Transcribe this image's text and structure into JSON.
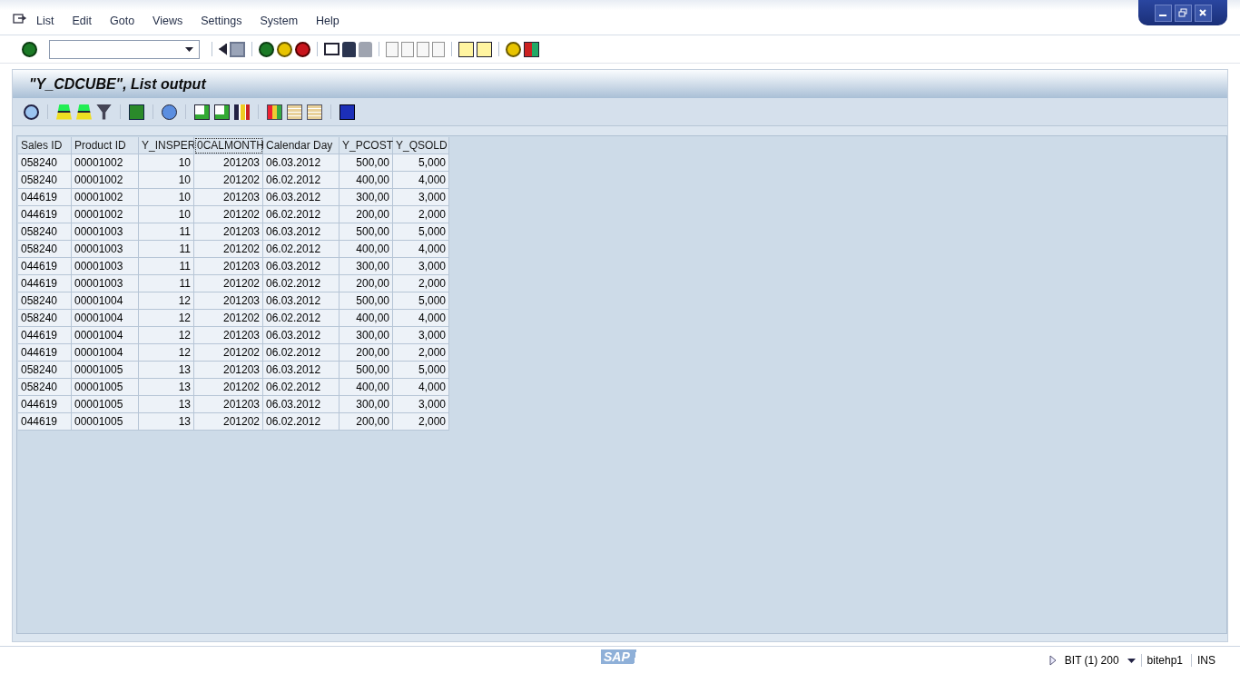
{
  "menu_bar": {
    "items": [
      "List",
      "Edit",
      "Goto",
      "Views",
      "Settings",
      "System",
      "Help"
    ]
  },
  "screen_title": "\"Y_CDCUBE\", List output",
  "table": {
    "columns": [
      {
        "label": "Sales ID",
        "kind": "text",
        "focused": false
      },
      {
        "label": "Product ID",
        "kind": "text",
        "focused": false
      },
      {
        "label": "Y_INSPER",
        "kind": "number",
        "focused": false
      },
      {
        "label": "0CALMONTH",
        "kind": "number",
        "focused": true
      },
      {
        "label": "Calendar Day",
        "kind": "text",
        "focused": false
      },
      {
        "label": "Y_PCOST",
        "kind": "number",
        "focused": false
      },
      {
        "label": "Y_QSOLD",
        "kind": "number",
        "focused": false
      }
    ],
    "rows": [
      [
        "058240",
        "00001002",
        "10",
        "201203",
        "06.03.2012",
        "500,00",
        "5,000"
      ],
      [
        "058240",
        "00001002",
        "10",
        "201202",
        "06.02.2012",
        "400,00",
        "4,000"
      ],
      [
        "044619",
        "00001002",
        "10",
        "201203",
        "06.03.2012",
        "300,00",
        "3,000"
      ],
      [
        "044619",
        "00001002",
        "10",
        "201202",
        "06.02.2012",
        "200,00",
        "2,000"
      ],
      [
        "058240",
        "00001003",
        "11",
        "201203",
        "06.03.2012",
        "500,00",
        "5,000"
      ],
      [
        "058240",
        "00001003",
        "11",
        "201202",
        "06.02.2012",
        "400,00",
        "4,000"
      ],
      [
        "044619",
        "00001003",
        "11",
        "201203",
        "06.03.2012",
        "300,00",
        "3,000"
      ],
      [
        "044619",
        "00001003",
        "11",
        "201202",
        "06.02.2012",
        "200,00",
        "2,000"
      ],
      [
        "058240",
        "00001004",
        "12",
        "201203",
        "06.03.2012",
        "500,00",
        "5,000"
      ],
      [
        "058240",
        "00001004",
        "12",
        "201202",
        "06.02.2012",
        "400,00",
        "4,000"
      ],
      [
        "044619",
        "00001004",
        "12",
        "201203",
        "06.03.2012",
        "300,00",
        "3,000"
      ],
      [
        "044619",
        "00001004",
        "12",
        "201202",
        "06.02.2012",
        "200,00",
        "2,000"
      ],
      [
        "058240",
        "00001005",
        "13",
        "201203",
        "06.03.2012",
        "500,00",
        "5,000"
      ],
      [
        "058240",
        "00001005",
        "13",
        "201202",
        "06.02.2012",
        "400,00",
        "4,000"
      ],
      [
        "044619",
        "00001005",
        "13",
        "201203",
        "06.03.2012",
        "300,00",
        "3,000"
      ],
      [
        "044619",
        "00001005",
        "13",
        "201202",
        "06.02.2012",
        "200,00",
        "2,000"
      ]
    ]
  },
  "status_bar": {
    "logo": "SAP",
    "system": "BIT (1) 200",
    "server": "bitehp1",
    "mode": "INS"
  }
}
